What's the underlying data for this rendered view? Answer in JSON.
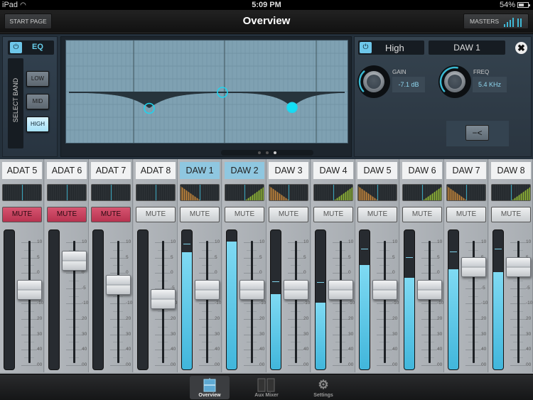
{
  "status_bar": {
    "device": "iPad",
    "time": "5:09 PM",
    "battery": "54%"
  },
  "header": {
    "title": "Overview",
    "start_page_label": "START PAGE",
    "masters_label": "MASTERS"
  },
  "eq": {
    "enabled": true,
    "label": "EQ",
    "select_band_label": "SELECT BAND",
    "bands": [
      {
        "label": "LOW",
        "active": false
      },
      {
        "label": "MID",
        "active": false
      },
      {
        "label": "HIGH",
        "active": true
      }
    ],
    "curve_points": [
      {
        "band": "LOW",
        "gain_db": -7.5,
        "selected": false
      },
      {
        "band": "MID",
        "gain_db": 0,
        "selected": false
      },
      {
        "band": "HIGH",
        "gain_db": -7.1,
        "selected": true
      }
    ],
    "page_dots": {
      "count": 3,
      "active": 3
    }
  },
  "band_editor": {
    "band_name": "High",
    "channel": "DAW 1",
    "gain": {
      "label": "GAIN",
      "value": "-7.1 dB",
      "knob_fraction": 0.35
    },
    "freq": {
      "label": "FREQ",
      "value": "5.4 KHz",
      "knob_fraction": 0.55
    },
    "filter_icon": "shelf-filter-icon",
    "close_icon": "close-icon"
  },
  "scale_labels": [
    "10",
    "5",
    "0",
    "-5",
    "-10",
    "20",
    "30",
    "40",
    "00"
  ],
  "mute_label": "MUTE",
  "channels": [
    {
      "name": "ADAT 5",
      "muted": true,
      "selected": false,
      "pan": 0,
      "fader_db_index": 3.1,
      "meter": 0,
      "peak": null
    },
    {
      "name": "ADAT 6",
      "muted": true,
      "selected": false,
      "pan": 0,
      "fader_db_index": 1.2,
      "meter": 0,
      "peak": null
    },
    {
      "name": "ADAT 7",
      "muted": true,
      "selected": false,
      "pan": 0,
      "fader_db_index": 2.8,
      "meter": 0,
      "peak": null
    },
    {
      "name": "ADAT 8",
      "muted": false,
      "selected": false,
      "pan": 0,
      "fader_db_index": 3.7,
      "meter": 0,
      "peak": null
    },
    {
      "name": "DAW 1",
      "muted": false,
      "selected": true,
      "pan": -1,
      "fader_db_index": 3.1,
      "meter": 0.84,
      "peak": 0.9
    },
    {
      "name": "DAW 2",
      "muted": false,
      "selected": true,
      "pan": 1,
      "fader_db_index": 3.1,
      "meter": 0.92,
      "peak": null
    },
    {
      "name": "DAW 3",
      "muted": false,
      "selected": false,
      "pan": -1,
      "fader_db_index": 3.1,
      "meter": 0.54,
      "peak": 0.63
    },
    {
      "name": "DAW 4",
      "muted": false,
      "selected": false,
      "pan": 1,
      "fader_db_index": 3.1,
      "meter": 0.48,
      "peak": 0.62
    },
    {
      "name": "DAW 5",
      "muted": false,
      "selected": false,
      "pan": -1,
      "fader_db_index": 3.1,
      "meter": 0.75,
      "peak": 0.86
    },
    {
      "name": "DAW 6",
      "muted": false,
      "selected": false,
      "pan": 1,
      "fader_db_index": 3.1,
      "meter": 0.66,
      "peak": 0.8
    },
    {
      "name": "DAW 7",
      "muted": false,
      "selected": false,
      "pan": -1,
      "fader_db_index": 1.6,
      "meter": 0.72,
      "peak": 0.84
    },
    {
      "name": "DAW 8",
      "muted": false,
      "selected": false,
      "pan": 1,
      "fader_db_index": 1.6,
      "meter": 0.7,
      "peak": 0.86
    }
  ],
  "tabs": [
    {
      "label": "Overview",
      "icon": "overview-icon",
      "active": true
    },
    {
      "label": "Aux Mixer",
      "icon": "aux-mixer-icon",
      "active": false
    },
    {
      "label": "Settings",
      "icon": "settings-gear-icon",
      "active": false
    }
  ]
}
